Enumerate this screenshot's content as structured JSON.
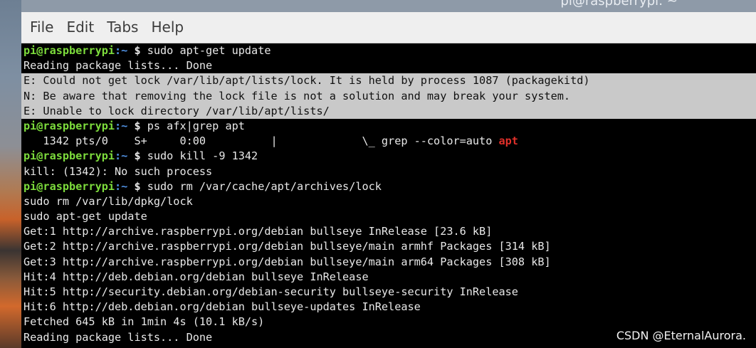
{
  "window": {
    "title": "pi@raspberrypi: ~"
  },
  "menu": [
    "File",
    "Edit",
    "Tabs",
    "Help"
  ],
  "prompt": {
    "user": "pi@raspberrypi",
    "path": ":~",
    "symbol": " $ "
  },
  "lines": [
    {
      "type": "prompt",
      "command": "sudo apt-get update"
    },
    {
      "type": "out",
      "text": "Reading package lists... Done"
    },
    {
      "type": "hl",
      "text": "E: Could not get lock /var/lib/apt/lists/lock. It is held by process 1087 (packagekitd)"
    },
    {
      "type": "hl",
      "text": "N: Be aware that removing the lock file is not a solution and may break your system."
    },
    {
      "type": "hl",
      "text": "E: Unable to lock directory /var/lib/apt/lists/"
    },
    {
      "type": "prompt",
      "command": "ps afx|grep apt"
    },
    {
      "type": "grep",
      "text": "   1342 pts/0    S+     0:00          |             \\_ grep --color=auto ",
      "match": "apt"
    },
    {
      "type": "prompt",
      "command": "sudo kill -9 1342"
    },
    {
      "type": "out",
      "text": "kill: (1342): No such process"
    },
    {
      "type": "prompt",
      "command": "sudo rm /var/cache/apt/archives/lock"
    },
    {
      "type": "out",
      "text": "sudo rm /var/lib/dpkg/lock"
    },
    {
      "type": "out",
      "text": "sudo apt-get update"
    },
    {
      "type": "out",
      "text": "Get:1 http://archive.raspberrypi.org/debian bullseye InRelease [23.6 kB]"
    },
    {
      "type": "out",
      "text": "Get:2 http://archive.raspberrypi.org/debian bullseye/main armhf Packages [314 kB]"
    },
    {
      "type": "out",
      "text": "Get:3 http://archive.raspberrypi.org/debian bullseye/main arm64 Packages [308 kB]"
    },
    {
      "type": "out",
      "text": "Hit:4 http://deb.debian.org/debian bullseye InRelease"
    },
    {
      "type": "out",
      "text": "Hit:5 http://security.debian.org/debian-security bullseye-security InRelease"
    },
    {
      "type": "out",
      "text": "Hit:6 http://deb.debian.org/debian bullseye-updates InRelease"
    },
    {
      "type": "out",
      "text": "Fetched 645 kB in 1min 4s (10.1 kB/s)"
    },
    {
      "type": "out",
      "text": "Reading package lists... Done"
    }
  ],
  "watermark": "CSDN @EternalAurora."
}
